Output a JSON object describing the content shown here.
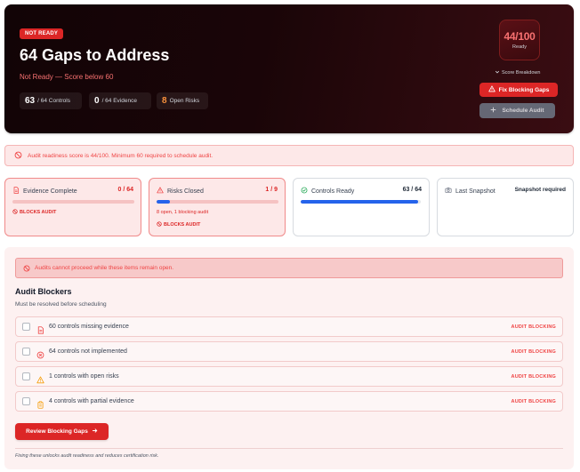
{
  "hero": {
    "badge": "NOT READY",
    "title": "64 Gaps to Address",
    "subtitle": "Not Ready — Score below 60",
    "stats": [
      {
        "value": "63",
        "label": "/ 64 Controls"
      },
      {
        "value": "0",
        "label": "/ 64 Evidence"
      },
      {
        "value": "8",
        "label": "Open Risks"
      }
    ],
    "score": "44/100",
    "score_label": "Ready",
    "score_breakdown": "Score Breakdown",
    "fix_button": "Fix Blocking Gaps",
    "schedule_button": "Schedule Audit"
  },
  "alert": {
    "text": "Audit readiness score is 44/100. Minimum 60 required to schedule audit."
  },
  "cards": {
    "evidence": {
      "title": "Evidence Complete",
      "count": "0 / 64",
      "progress": 0,
      "blocks": "BLOCKS AUDIT"
    },
    "risks": {
      "title": "Risks Closed",
      "count": "1 / 9",
      "progress": 0.11,
      "note": "8 open, 1 blocking audit",
      "blocks": "BLOCKS AUDIT"
    },
    "controls": {
      "title": "Controls Ready",
      "count": "63 / 64",
      "progress": 0.98
    },
    "snapshot": {
      "title": "Last Snapshot",
      "value": "Snapshot required"
    }
  },
  "blockers": {
    "alert": "Audits cannot proceed while these items remain open.",
    "title": "Audit Blockers",
    "subtitle": "Must be resolved before scheduling",
    "items": [
      {
        "label": "60 controls missing evidence",
        "tag": "AUDIT BLOCKING",
        "icon": "document-icon"
      },
      {
        "label": "64 controls not implemented",
        "tag": "AUDIT BLOCKING",
        "icon": "x-circle-icon"
      },
      {
        "label": "1 controls with open risks",
        "tag": "AUDIT BLOCKING",
        "icon": "warning-icon"
      },
      {
        "label": "4 controls with partial evidence",
        "tag": "AUDIT BLOCKING",
        "icon": "clipboard-icon"
      }
    ],
    "review_button": "Review Blocking Gaps",
    "footer": "Fixing these unlocks audit readiness and reduces certification risk."
  },
  "colors": {
    "accent_red": "#dc2626",
    "progress_blue": "#2563eb",
    "hero_dark": "#120406"
  }
}
